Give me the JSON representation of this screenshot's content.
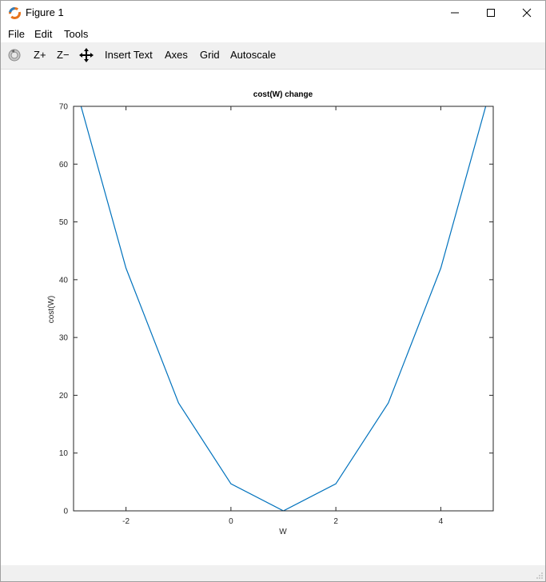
{
  "window": {
    "title": "Figure 1",
    "minimize_icon": "minimize-icon",
    "maximize_icon": "maximize-icon",
    "close_icon": "close-icon"
  },
  "menubar": {
    "items": [
      "File",
      "Edit",
      "Tools"
    ]
  },
  "toolbar": {
    "rotate_icon": "rotate-icon",
    "zoom_in_label": "Z+",
    "zoom_out_label": "Z−",
    "pan_icon": "pan-icon",
    "insert_text_label": "Insert Text",
    "axes_label": "Axes",
    "grid_label": "Grid",
    "autoscale_label": "Autoscale"
  },
  "chart_data": {
    "type": "line",
    "title": "cost(W) change",
    "xlabel": "W",
    "ylabel": "cost(W)",
    "xlim": [
      -3,
      5
    ],
    "ylim": [
      0,
      70
    ],
    "xticks": [
      -2,
      0,
      2,
      4
    ],
    "yticks": [
      0,
      10,
      20,
      30,
      40,
      50,
      60,
      70
    ],
    "grid": false,
    "line_color": "#0072bd",
    "series": [
      {
        "x": [
          -3,
          -2,
          -1,
          0,
          1,
          2,
          3,
          4,
          5
        ],
        "values": [
          74.67,
          42,
          18.67,
          4.67,
          0,
          4.67,
          18.67,
          42,
          74.67
        ]
      }
    ]
  }
}
